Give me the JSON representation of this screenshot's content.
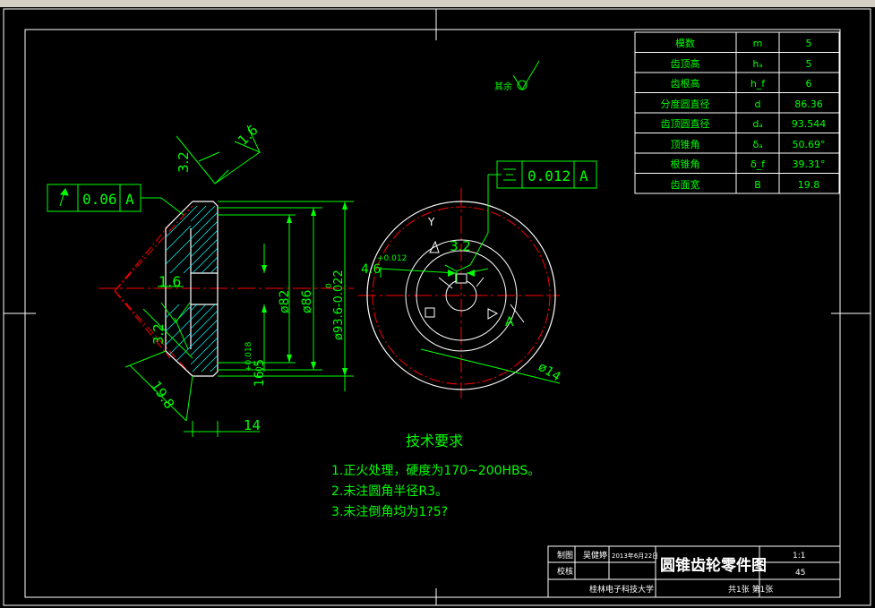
{
  "colors": {
    "background": "#000000",
    "green": "#00ff00",
    "white": "#ffffff",
    "red": "#ff0000",
    "cyan": "#00ffff",
    "yellow": "#ffff00"
  },
  "params_table": {
    "rows": [
      {
        "name": "模数",
        "symbol": "m",
        "value": "5"
      },
      {
        "name": "齿顶高",
        "symbol": "hₐ",
        "value": "5"
      },
      {
        "name": "齿根高",
        "symbol": "h_f",
        "value": "6"
      },
      {
        "name": "分度圆直径",
        "symbol": "d",
        "value": "86.36"
      },
      {
        "name": "齿顶圆直径",
        "symbol": "dₐ",
        "value": "93.544"
      },
      {
        "name": "顶锥角",
        "symbol": "δₐ",
        "value": "50.69°"
      },
      {
        "name": "根锥角",
        "symbol": "δ_f",
        "value": "39.31°"
      },
      {
        "name": "齿面宽",
        "symbol": "B",
        "value": "19.8"
      }
    ]
  },
  "surface_note": "其余",
  "runout_tol": {
    "value": "0.06",
    "datum": "A"
  },
  "sym_tol": {
    "value": "0.012",
    "datum": "A"
  },
  "roughness": {
    "r1": "1.6",
    "r2": "3.2",
    "r3": "1.6",
    "r4": "3.2",
    "r5": "3.2"
  },
  "dims": {
    "d82": "ø82",
    "d86": "ø86",
    "d93": "ø93.6-0.022",
    "d93_sup": "0",
    "bore": "16.5",
    "bore_tol": "+0.018",
    "bore_tol2": "0",
    "width": "19.8",
    "hub": "14",
    "key": "4.6",
    "key_tol": "+0.012",
    "d14": "ø14",
    "datum_a": "A",
    "y_label": "Y"
  },
  "tech_req": {
    "title": "技术要求",
    "items": [
      "1.正火处理，硬度为170~200HBS。",
      "2.未注圆角半径R3。",
      "3.未注倒角均为1?5?"
    ]
  },
  "title_block": {
    "drawn_label": "制图",
    "drawn_name": "吴健婷",
    "date": "2013年6月22日",
    "check_label": "校核",
    "title": "圆锥齿轮零件图",
    "scale": "1:1",
    "code": "45",
    "school": "桂林电子科技大学",
    "sheets": "共1张  第1张"
  }
}
